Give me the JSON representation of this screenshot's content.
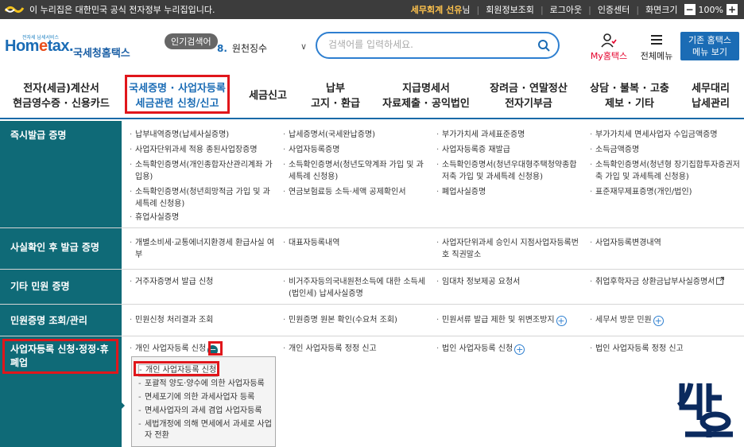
{
  "gov_bar": {
    "notice": "이 누리집은 대한민국 공식 전자정부 누리집입니다.",
    "user_name": "세무회계 선유",
    "user_suffix": "님",
    "links": [
      "회원정보조회",
      "로그아웃",
      "인증센터",
      "화면크기"
    ],
    "zoom_minus": "−",
    "zoom_value": "100%",
    "zoom_plus": "+"
  },
  "header": {
    "logo_small": "전자세 납세서비스",
    "logo_word_a": "Hom",
    "logo_word_b": "e",
    "logo_word_c": "tax.",
    "logo_kor": "국세청홈택스",
    "popular_label": "인기검색어",
    "popular_num": "8.",
    "popular_text": "원천징수",
    "search_placeholder": "검색어를 입력하세요.",
    "myhome_label": "My홈택스",
    "allmenu_label": "전체메뉴",
    "legacy_line1": "기존 홈택스",
    "legacy_line2": "메뉴 보기"
  },
  "gnb": [
    {
      "line1": "전자(세금)계산서",
      "line2": "현금영수증 · 신용카드"
    },
    {
      "line1": "국세증명 · 사업자등록",
      "line2": "세금관련 신청/신고"
    },
    {
      "line1": "세금신고",
      "line2": ""
    },
    {
      "line1": "납부",
      "line2": "고지 · 환급"
    },
    {
      "line1": "지급명세서",
      "line2": "자료제출 · 공익법인"
    },
    {
      "line1": "장려금 · 연말정산",
      "line2": "전자기부금"
    },
    {
      "line1": "상담 · 불복 · 고충",
      "line2": "제보 · 기타"
    },
    {
      "line1": "세무대리",
      "line2": "납세관리"
    }
  ],
  "rows": [
    {
      "category": "즉시발급 증명",
      "items": [
        [
          "납부내역증명(납세사실증명)",
          "납세증명서(국세완납증명)",
          "부가가치세 과세표준증명",
          "부가가치세 면세사업자 수입금액증명"
        ],
        [
          "사업자단위과세 적용 종된사업장증명",
          "사업자등록증명",
          "사업자등록증 재발급",
          "소득금액증명"
        ],
        [
          "소득확인증명서(개인종합자산관리계좌 가입용)",
          "소득확인증명서(청년도약계좌 가입 및 과세특례 신청용)",
          "소득확인증명서(청년우대형주택청약종합저축 가입 및 과세특례 신청용)",
          "소득확인증명서(청년형 장기집합투자증권저축 가입 및 과세특례 신청용)"
        ],
        [
          "소득확인증명서(청년희망적금 가입 및 과세특례 신청용)",
          "연금보험료등 소득·세액 공제확인서",
          "폐업사실증명",
          "표준재무제표증명(개인/법인)"
        ],
        [
          "휴업사실증명"
        ]
      ]
    },
    {
      "category": "사실확인 후 발급 증명",
      "items": [
        [
          "개별소비세·교통에너지환경세 환급사실 여부",
          "대표자등록내역",
          "사업자단위과세 승인시 지점사업자등록번호 직권말소",
          "사업자등록변경내역"
        ]
      ]
    },
    {
      "category": "기타 민원 증명",
      "items": [
        [
          "거주자증명서 발급 신청",
          "비거주자등의국내원천소득에 대한 소득세(법인세) 납세사실증명",
          "임대차 정보제공 요청서",
          "취업후학자금 상환금납부사실증명서"
        ]
      ]
    },
    {
      "category": "민원증명 조회/관리",
      "items": [
        [
          "민원신청 처리결과 조회",
          "민원증명 원본 확인(수요처 조회)",
          "민원서류 발급 제한 및 위변조방지",
          "세무서 방문 민원"
        ]
      ]
    },
    {
      "category": "사업자등록 신청·정정·휴폐업",
      "items": [
        [
          "개인 사업자등록 신청",
          "개인 사업자등록 정정 신고",
          "법인 사업자등록 신청",
          "법인 사업자등록 정정 신고"
        ]
      ]
    }
  ],
  "submenu": [
    "개인 사업자등록 신청",
    "포괄적 양도·양수에 의한 사업자등록",
    "면세포기에 의한 과세사업자 등록",
    "면세사업자의 과세 겸업 사업자등록",
    "세법개정에 의해 면세에서 과세로 사업자 전환"
  ],
  "colors": {
    "accent": "#1b6cb5",
    "category_bg": "#0f6a77",
    "highlight": "#e0161b",
    "gov_bar": "#3c3c3c"
  }
}
